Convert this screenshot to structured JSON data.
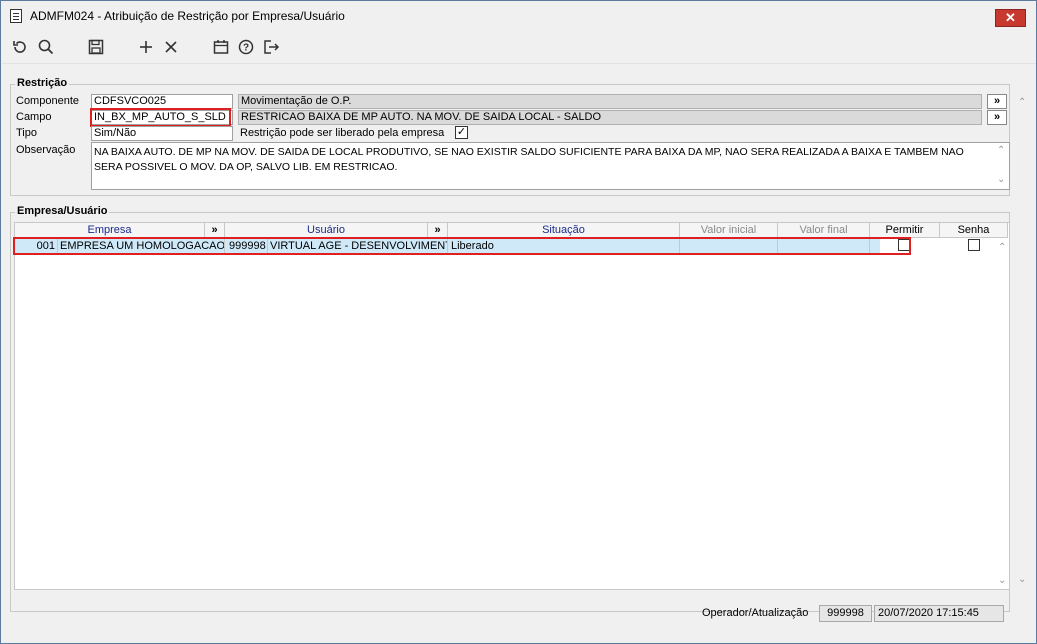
{
  "window": {
    "title": "ADMFM024 - Atribuição de Restrição por Empresa/Usuário",
    "close_label": "✕"
  },
  "toolbar": {
    "items": [
      {
        "name": "refresh-icon",
        "glyph": "↺"
      },
      {
        "name": "search-icon",
        "glyph": "🔍"
      },
      {
        "name": "save-icon",
        "glyph": "💾"
      },
      {
        "name": "add-icon",
        "glyph": "+"
      },
      {
        "name": "delete-icon",
        "glyph": "✕"
      },
      {
        "name": "calendar-icon",
        "glyph": "📅"
      },
      {
        "name": "help-icon",
        "glyph": "?"
      },
      {
        "name": "exit-icon",
        "glyph": "⇥"
      }
    ]
  },
  "restricao": {
    "title": "Restrição",
    "componente_label": "Componente",
    "componente_value": "CDFSVCO025",
    "componente_desc": "Movimentação de O.P.",
    "campo_label": "Campo",
    "campo_value": "IN_BX_MP_AUTO_S_SLD",
    "campo_desc": "RESTRICAO BAIXA DE MP AUTO. NA MOV. DE SAIDA LOCAL - SALDO",
    "tipo_label": "Tipo",
    "tipo_value": "Sim/Não",
    "liberado_label": "Restrição pode ser liberado pela empresa",
    "liberado_checked": "✓",
    "observacao_label": "Observação",
    "observacao_text": "NA BAIXA AUTO. DE MP NA MOV. DE SAIDA DE LOCAL PRODUTIVO, SE NAO EXISTIR SALDO SUFICIENTE PARA BAIXA DA MP, NAO SERA REALIZADA A BAIXA E TAMBEM NAO SERA POSSIVEL O MOV. DA OP, SALVO LIB. EM RESTRICAO.",
    "expand_label": "»"
  },
  "grid": {
    "title": "Empresa/Usuário",
    "headers": {
      "empresa": "Empresa",
      "usuario": "Usuário",
      "situacao": "Situação",
      "valor_inicial": "Valor inicial",
      "valor_final": "Valor final",
      "permitir": "Permitir",
      "senha": "Senha",
      "expand": "»"
    },
    "rows": [
      {
        "empresa_cod": "001",
        "empresa_nome": "EMPRESA UM  HOMOLOGACAO",
        "usuario_cod": "999998",
        "usuario_nome": "VIRTUAL AGE - DESENVOLVIMENTO",
        "situacao": "Liberado",
        "valor_inicial": "",
        "valor_final": "",
        "permitir": "",
        "senha": ""
      }
    ]
  },
  "status": {
    "label": "Operador/Atualização",
    "operador": "999998",
    "data": "20/07/2020 17:15:45"
  },
  "scroll": {
    "up": "⌃",
    "down": "⌄"
  }
}
